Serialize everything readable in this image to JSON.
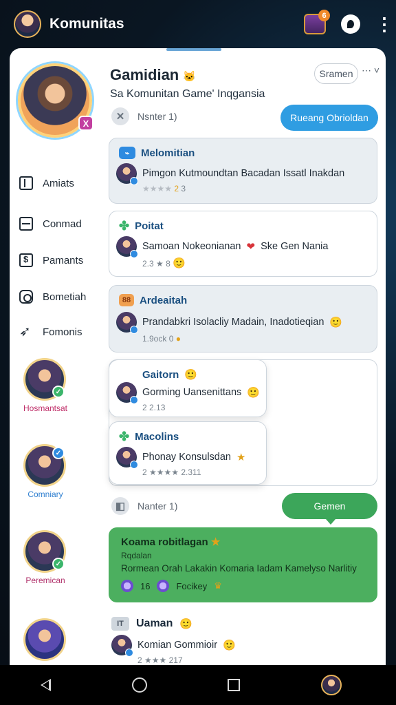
{
  "app": {
    "title": "Komunitas",
    "notification_count": "6"
  },
  "community": {
    "title": "Gamidian",
    "title_emoji": "🐱",
    "subtitle": "Sa Komunitan Game' Inqgansia",
    "share_label": "Sramen",
    "more_toggle": "⋯ ˅",
    "members_label_1": "Nsnter 1)",
    "primary_button": "Rueang Obrioldan",
    "hero_badge": "X"
  },
  "sidebar": {
    "items": [
      {
        "label": "Amiats"
      },
      {
        "label": "Conmad"
      },
      {
        "label": "Pamants"
      },
      {
        "label": "Bometiah"
      },
      {
        "label": "Fomonis"
      }
    ],
    "members": [
      {
        "name": "Hosmantsat",
        "color": "#c0306a"
      },
      {
        "name": "Comniary",
        "color": "#2f7fd0"
      },
      {
        "name": "Peremican",
        "color": "#b0306a"
      },
      {
        "name": ""
      }
    ]
  },
  "posts": [
    {
      "title": "Melomitian",
      "text": "Pimgon Kutmoundtan Bacadan Issatl Inakdan",
      "meta_stars": "★★★★",
      "meta_num": "2",
      "meta_tail": "3"
    },
    {
      "title": "Poitat",
      "text": "Samoan Nokeonianan",
      "text_tail": "Ske Gen Nania",
      "meta": "2.3 ★ 8"
    },
    {
      "title": "Ardeaitah",
      "text": "Prandabkri Isolacliy Madain, Inadotieqian",
      "meta": "1.9ock  0"
    },
    {
      "title": "Gaitorn",
      "text": "Gorming Uansenittans",
      "meta": "2 2.13"
    },
    {
      "title": "Macolins",
      "text": "Phonay Konsulsdan",
      "meta": "2 ★★★★ 2.311"
    }
  ],
  "members_label_2": "Nanter 1)",
  "green_button": "Gemen",
  "banner": {
    "title": "Koama robitlagan",
    "sub": "Rqdalan",
    "text": "Rormean Orah Lakakin Komaria Iadam Kamelyso Narlitiy",
    "foot_num": "16",
    "foot_label": "Focikey"
  },
  "last_post": {
    "icon_text": "IT",
    "title": "Uaman",
    "text": "Komian Gommioir",
    "meta": "2 ★★★ 217"
  },
  "colors": {
    "primary_blue": "#2f9de2",
    "green": "#4caf5f",
    "dark_bg": "#0a1622"
  }
}
